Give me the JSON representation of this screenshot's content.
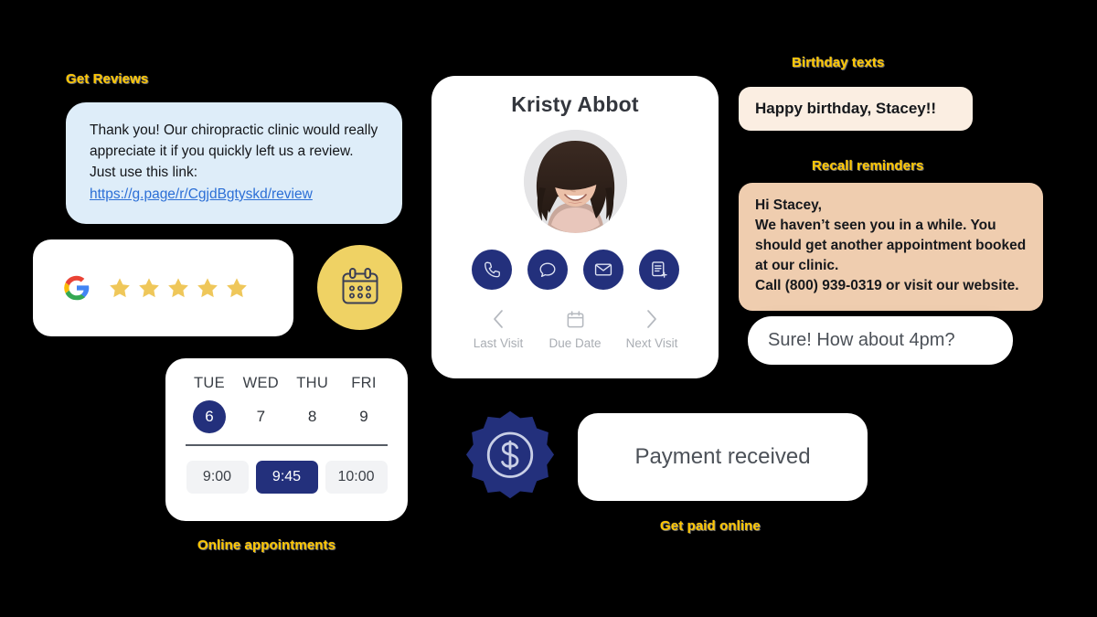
{
  "labels": {
    "get_reviews": "Get Reviews",
    "birthday_texts": "Birthday texts",
    "recall_reminders": "Recall reminders",
    "online_appointments": "Online appointments",
    "get_paid_online": "Get paid online"
  },
  "review_bubble": {
    "text": "Thank you! Our chiropractic clinic would really appreciate it if you quickly left us a review. Just use this link:",
    "link": "https://g.page/r/CgjdBgtyskd/review"
  },
  "google_card": {
    "logo": "google-logo",
    "star_count": 5,
    "star_color": "#EFC75A"
  },
  "calendar_circle": {
    "icon": "calendar-icon",
    "bg": "#EFD264"
  },
  "appointment": {
    "days": [
      "TUE",
      "WED",
      "THU",
      "FRI"
    ],
    "dates": [
      "6",
      "7",
      "8",
      "9"
    ],
    "selected_date": "6",
    "slots": [
      "9:00",
      "9:45",
      "10:00"
    ],
    "selected_slot": "9:45",
    "accent": "#23307C"
  },
  "profile": {
    "name": "Kristy Abbot",
    "avatar_alt": "patient-photo",
    "actions": [
      {
        "name": "call-button",
        "icon": "phone-icon"
      },
      {
        "name": "message-button",
        "icon": "chat-bubble-icon"
      },
      {
        "name": "email-button",
        "icon": "envelope-icon"
      },
      {
        "name": "add-note-button",
        "icon": "document-plus-icon"
      }
    ],
    "nav": [
      {
        "name": "last-visit",
        "icon": "chevron-left-icon",
        "label": "Last Visit"
      },
      {
        "name": "due-date",
        "icon": "calendar-icon",
        "label": "Due Date"
      },
      {
        "name": "next-visit",
        "icon": "chevron-right-icon",
        "label": "Next Visit"
      }
    ]
  },
  "messages": {
    "birthday": "Happy birthday, Stacey!!",
    "recall_lines": [
      "Hi Stacey,",
      "We haven’t seen you in a while. You",
      "should get another appointment booked",
      "at our clinic.",
      "Call  (800) 939-0319 or visit our website."
    ],
    "reply": "Sure! How about 4pm?"
  },
  "payment": {
    "badge_icon": "dollar-badge-icon",
    "status": "Payment received"
  },
  "colors": {
    "navy": "#23307C",
    "yellow": "#FFC700",
    "bubble_blue": "#DEEDF9",
    "cream": "#FBEEE2",
    "peach": "#EFCDAF",
    "background": "#000000"
  }
}
